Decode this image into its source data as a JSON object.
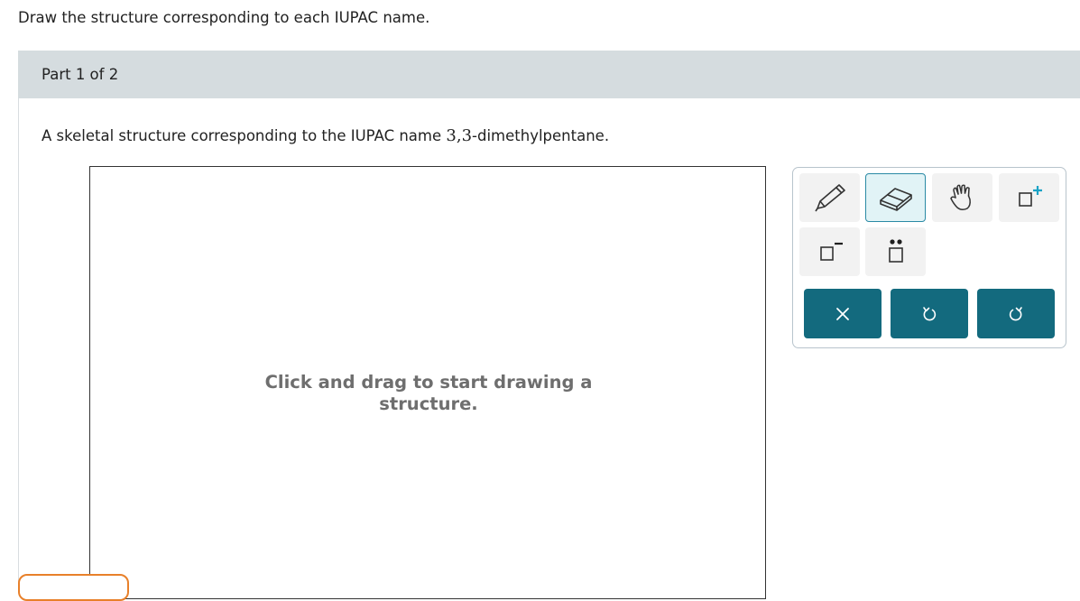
{
  "instruction": "Draw the structure corresponding to each IUPAC name.",
  "part": {
    "label": "Part 1 of 2"
  },
  "question": {
    "prefix": "A skeletal structure corresponding to the IUPAC name ",
    "name": "3,3",
    "suffix": "-dimethylpentane."
  },
  "canvas": {
    "hint_line1": "Click and drag to start drawing a",
    "hint_line2": "structure."
  },
  "toolbar": {
    "tools": [
      {
        "name": "pencil-tool",
        "icon": "pencil-icon",
        "active": false
      },
      {
        "name": "eraser-tool",
        "icon": "eraser-icon",
        "active": true
      },
      {
        "name": "hand-tool",
        "icon": "hand-icon",
        "active": false
      },
      {
        "name": "add-charge-tool",
        "icon": "positive-charge-icon",
        "active": false
      },
      {
        "name": "subtract-charge-tool",
        "icon": "negative-charge-icon",
        "active": false
      },
      {
        "name": "lone-pair-tool",
        "icon": "lone-pair-icon",
        "active": false
      }
    ],
    "actions": [
      {
        "name": "clear-button",
        "icon": "close-icon"
      },
      {
        "name": "undo-button",
        "icon": "undo-icon"
      },
      {
        "name": "redo-button",
        "icon": "redo-icon"
      }
    ]
  },
  "colors": {
    "accent": "#136a7e",
    "active_tool_bg": "#e1f3f6",
    "header_bg": "#d5dcdf",
    "charge_plus": "#1ba3c6",
    "tab_outline": "#e8802a"
  }
}
